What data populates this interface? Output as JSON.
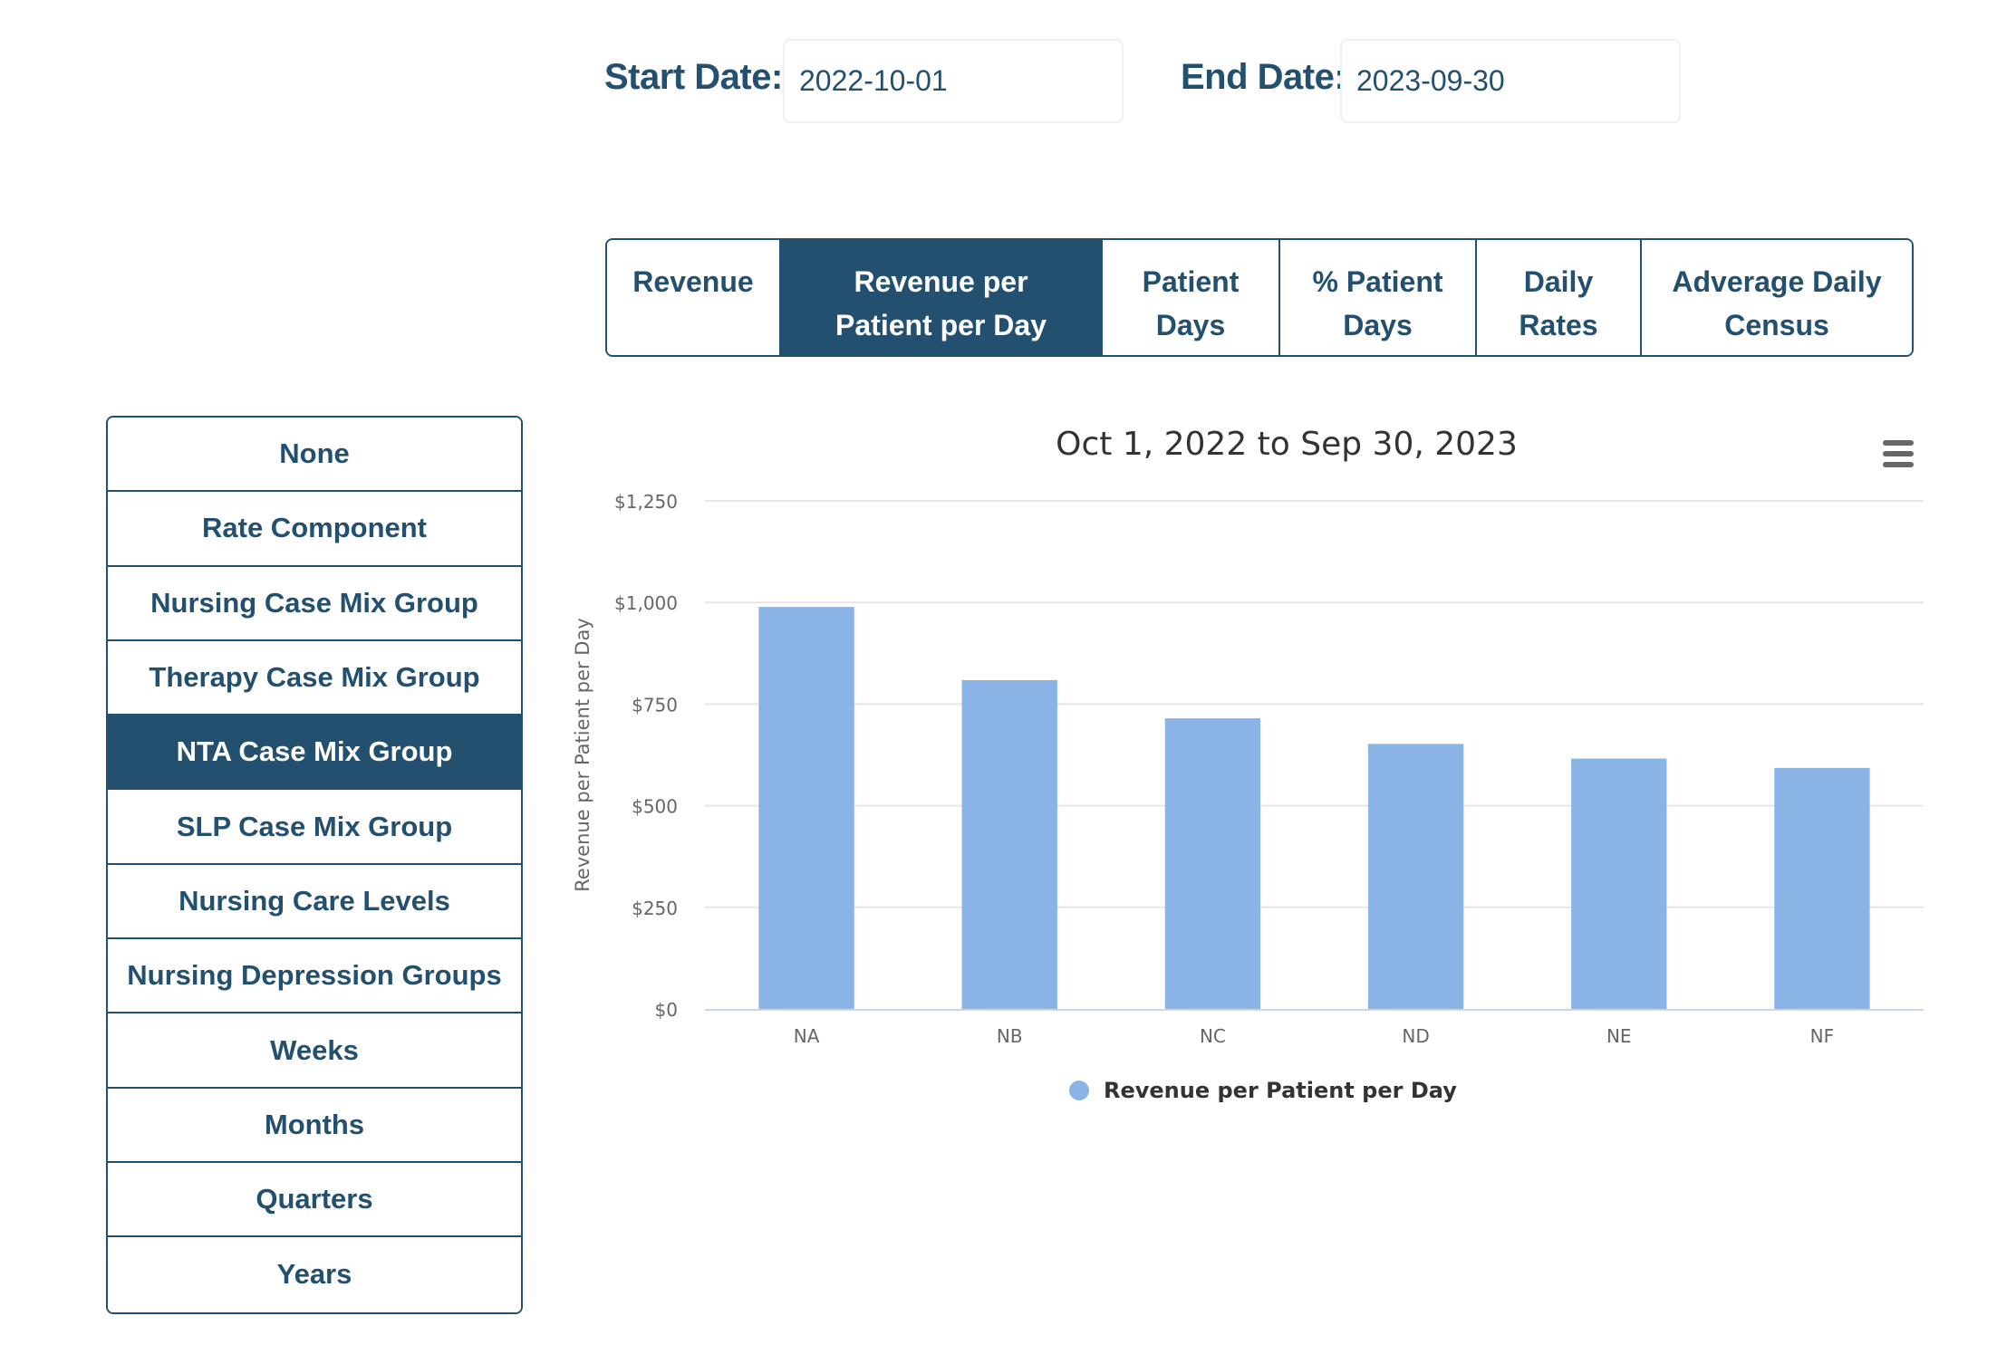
{
  "filters": {
    "start_label": "Start Date:",
    "start_value": "2022-10-01",
    "end_label": "End Date:",
    "end_value": "2023-09-30"
  },
  "metric_tabs": [
    {
      "label": "Revenue",
      "active": false
    },
    {
      "label": "Revenue per Patient per Day",
      "active": true
    },
    {
      "label": "Patient Days",
      "active": false
    },
    {
      "label": "% Patient Days",
      "active": false
    },
    {
      "label": "Daily Rates",
      "active": false
    },
    {
      "label": "Adverage Daily Census",
      "active": false
    }
  ],
  "group_by": [
    {
      "label": "None",
      "active": false
    },
    {
      "label": "Rate Component",
      "active": false
    },
    {
      "label": "Nursing Case Mix Group",
      "active": false
    },
    {
      "label": "Therapy Case Mix Group",
      "active": false
    },
    {
      "label": "NTA Case Mix Group",
      "active": true
    },
    {
      "label": "SLP Case Mix Group",
      "active": false
    },
    {
      "label": "Nursing Care Levels",
      "active": false
    },
    {
      "label": "Nursing Depression Groups",
      "active": false
    },
    {
      "label": "Weeks",
      "active": false
    },
    {
      "label": "Months",
      "active": false
    },
    {
      "label": "Quarters",
      "active": false
    },
    {
      "label": "Years",
      "active": false
    }
  ],
  "colors": {
    "brand": "#24506f",
    "bar": "#8ab4e6",
    "grid": "#e6e6e6"
  },
  "chart_menu_icon": "hamburger-menu-icon",
  "chart_data": {
    "type": "bar",
    "title": "Oct 1, 2022 to Sep 30, 2023",
    "xlabel": "",
    "ylabel": "Revenue per Patient per Day",
    "categories": [
      "NA",
      "NB",
      "NC",
      "ND",
      "NE",
      "NF"
    ],
    "series": [
      {
        "name": "Revenue per Patient per Day",
        "values": [
          989,
          809,
          715,
          652,
          616,
          593
        ]
      }
    ],
    "ylim": [
      0,
      1250
    ],
    "yticks": [
      0,
      250,
      500,
      750,
      1000,
      1250
    ],
    "ytick_labels": [
      "$0",
      "$250",
      "$500",
      "$750",
      "$1,000",
      "$1,250"
    ],
    "grid": true,
    "legend": "bottom-center"
  }
}
